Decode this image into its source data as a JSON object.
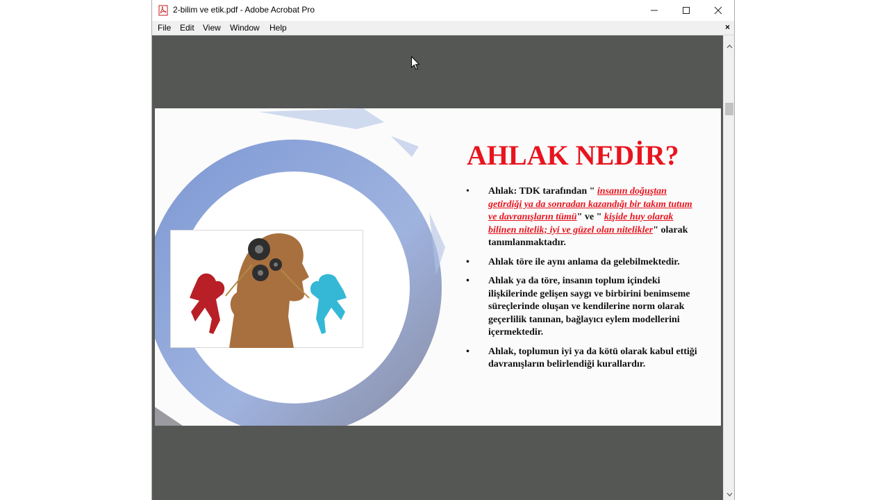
{
  "window": {
    "title": "2-bilim ve etik.pdf - Adobe Acrobat Pro",
    "controls": {
      "minimize": "—",
      "maximize": "☐",
      "close": "✕"
    }
  },
  "menu": {
    "items": [
      "File",
      "Edit",
      "View",
      "Window",
      "Help"
    ],
    "close_doc": "×"
  },
  "slide": {
    "title": "AHLAK NEDİR?",
    "bullet1": {
      "prefix": "Ahlak: TDK tarafından \" ",
      "quote1": "insanın doğuştan getirdiği ya da sonradan kazandığı bir takım tutum ve davranışların tümü",
      "middle": "\" ve \" ",
      "quote2": "kişide huy olarak bilinen nitelik; iyi ve güzel olan nitelikler",
      "suffix": "\" olarak tanımlanmaktadır."
    },
    "bullet2": "Ahlak töre ile aynı anlama da gelebilmektedir.",
    "bullet3": "Ahlak ya da töre, insanın toplum içindeki ilişkilerinde gelişen saygı ve birbirini benimseme süreçlerinde oluşan ve kendilerine norm olarak geçerlilik tanınan, bağlayıcı eylem modellerini içermektedir.",
    "bullet4": "Ahlak, toplumun iyi ya da kötü olarak kabul ettiği davranışların belirlendiği kurallardır."
  },
  "colors": {
    "title_red": "#e8141e",
    "viewer_bg": "#555755",
    "ring_blue": "#8ea6d8"
  }
}
